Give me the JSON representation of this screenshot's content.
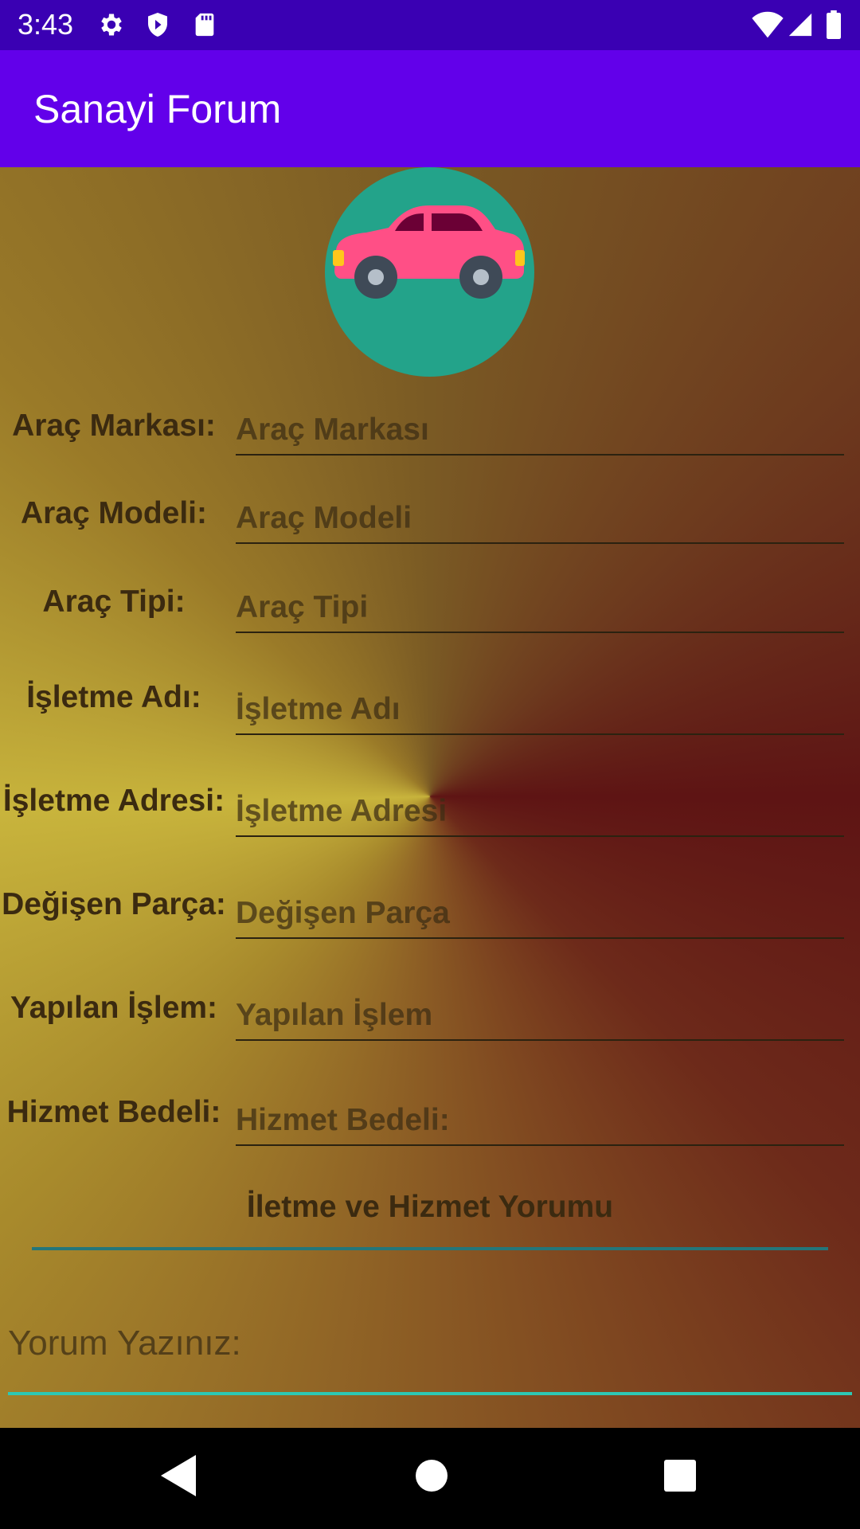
{
  "status_bar": {
    "time": "3:43",
    "icons": [
      "gear-icon",
      "shield-icon",
      "sd-card-icon",
      "wifi-icon",
      "signal-icon",
      "battery-icon"
    ]
  },
  "app_bar": {
    "title": "Sanayi Forum"
  },
  "colors": {
    "status_bar": "#3a00b3",
    "app_bar": "#6200ea",
    "avatar_bg": "#23a38a",
    "car_body": "#ff4f86",
    "accent_line": "#2dc8b4"
  },
  "avatar": {
    "icon": "car-icon"
  },
  "form": {
    "rows": [
      {
        "label": "Araç Markası:",
        "placeholder": "Araç Markası"
      },
      {
        "label": "Araç Modeli:",
        "placeholder": "Araç Modeli"
      },
      {
        "label": "Araç Tipi:",
        "placeholder": "Araç Tipi"
      },
      {
        "label": "İşletme Adı:",
        "placeholder": "İşletme Adı"
      },
      {
        "label": "İşletme Adresi:",
        "placeholder": "İşletme Adresi"
      },
      {
        "label": "Değişen Parça:",
        "placeholder": "Değişen Parça"
      },
      {
        "label": "Yapılan İşlem:",
        "placeholder": "Yapılan İşlem"
      },
      {
        "label": "Hizmet Bedeli:",
        "placeholder": "Hizmet Bedeli:"
      }
    ]
  },
  "comment": {
    "heading": "İletme ve Hizmet Yorumu",
    "placeholder": "Yorum Yazınız:"
  },
  "nav_bar": {
    "icons": [
      "back-icon",
      "home-icon",
      "recents-icon"
    ]
  }
}
